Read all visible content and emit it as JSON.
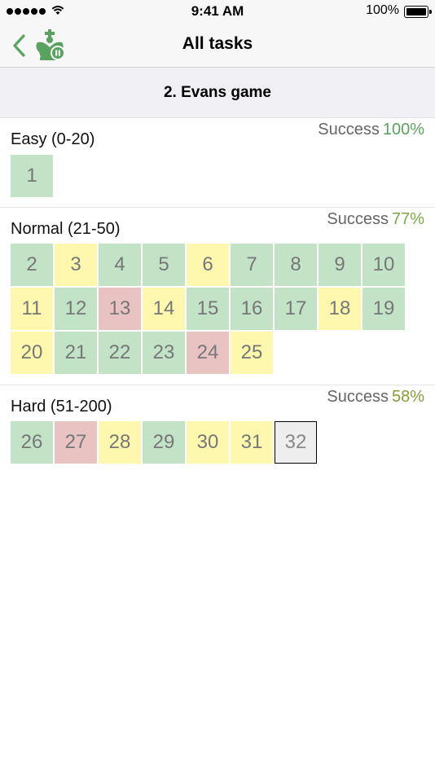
{
  "status_bar": {
    "time": "9:41 AM",
    "battery": "100%"
  },
  "navbar": {
    "title": "All tasks",
    "back_icon": "chevron-left-icon",
    "logo_icon": "chess-king-logo-icon",
    "accent_color": "#5aa35f"
  },
  "subheader": {
    "title": "2. Evans game"
  },
  "colors": {
    "success": "#c3e3c6",
    "partial": "#fef8ae",
    "fail": "#e8c3c1",
    "current": "#eeeeee",
    "pct_high": "#5aa35f",
    "pct_mid": "#8a9a3a"
  },
  "sections": [
    {
      "title": "Easy (0-20)",
      "success_label": "Success",
      "success_value": "100%",
      "tasks": [
        {
          "num": "1",
          "status": "success"
        }
      ]
    },
    {
      "title": "Normal (21-50)",
      "success_label": "Success",
      "success_value": "77%",
      "tasks": [
        {
          "num": "2",
          "status": "success"
        },
        {
          "num": "3",
          "status": "partial"
        },
        {
          "num": "4",
          "status": "success"
        },
        {
          "num": "5",
          "status": "success"
        },
        {
          "num": "6",
          "status": "partial"
        },
        {
          "num": "7",
          "status": "success"
        },
        {
          "num": "8",
          "status": "success"
        },
        {
          "num": "9",
          "status": "success"
        },
        {
          "num": "10",
          "status": "success"
        },
        {
          "num": "11",
          "status": "partial"
        },
        {
          "num": "12",
          "status": "success"
        },
        {
          "num": "13",
          "status": "fail"
        },
        {
          "num": "14",
          "status": "partial"
        },
        {
          "num": "15",
          "status": "success"
        },
        {
          "num": "16",
          "status": "success"
        },
        {
          "num": "17",
          "status": "success"
        },
        {
          "num": "18",
          "status": "partial"
        },
        {
          "num": "19",
          "status": "success"
        },
        {
          "num": "20",
          "status": "partial"
        },
        {
          "num": "21",
          "status": "success"
        },
        {
          "num": "22",
          "status": "success"
        },
        {
          "num": "23",
          "status": "success"
        },
        {
          "num": "24",
          "status": "fail"
        },
        {
          "num": "25",
          "status": "partial"
        }
      ]
    },
    {
      "title": "Hard (51-200)",
      "success_label": "Success",
      "success_value": "58%",
      "tasks": [
        {
          "num": "26",
          "status": "success"
        },
        {
          "num": "27",
          "status": "fail"
        },
        {
          "num": "28",
          "status": "partial"
        },
        {
          "num": "29",
          "status": "success"
        },
        {
          "num": "30",
          "status": "partial"
        },
        {
          "num": "31",
          "status": "partial"
        },
        {
          "num": "32",
          "status": "current"
        }
      ]
    }
  ]
}
